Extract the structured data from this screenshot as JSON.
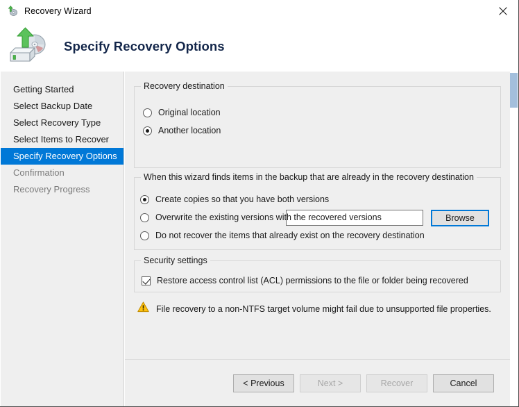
{
  "window": {
    "title": "Recovery Wizard",
    "title_icon": "recovery-disk-icon",
    "close_icon": "close-icon"
  },
  "header": {
    "title": "Specify Recovery Options",
    "icon": "recovery-disk-drive-icon"
  },
  "sidebar": {
    "items": [
      {
        "label": "Getting Started",
        "state": "normal"
      },
      {
        "label": "Select Backup Date",
        "state": "normal"
      },
      {
        "label": "Select Recovery Type",
        "state": "normal"
      },
      {
        "label": "Select Items to Recover",
        "state": "normal"
      },
      {
        "label": "Specify Recovery Options",
        "state": "selected"
      },
      {
        "label": "Confirmation",
        "state": "dim"
      },
      {
        "label": "Recovery Progress",
        "state": "dim"
      }
    ]
  },
  "destination_group": {
    "legend": "Recovery destination",
    "options": [
      {
        "label": "Original location",
        "checked": false
      },
      {
        "label": "Another location",
        "checked": true
      }
    ],
    "path_value": "",
    "path_placeholder": "",
    "browse_label": "Browse"
  },
  "conflict_group": {
    "legend": "When this wizard finds items in the backup that are already in the recovery destination",
    "options": [
      {
        "label": "Create copies so that you have both versions",
        "checked": true
      },
      {
        "label": "Overwrite the existing versions with the recovered versions",
        "checked": false
      },
      {
        "label": "Do not recover the items that already exist on the recovery destination",
        "checked": false
      }
    ]
  },
  "security_group": {
    "legend": "Security settings",
    "checkbox": {
      "label": "Restore access control list (ACL) permissions to the file or folder being recovered",
      "checked": true
    }
  },
  "warning": {
    "icon": "warning-triangle-icon",
    "text": "File recovery to a non-NTFS target volume might fail due to unsupported file properties."
  },
  "footer": {
    "buttons": [
      {
        "label": "< Previous",
        "enabled": true
      },
      {
        "label": "Next >",
        "enabled": false
      },
      {
        "label": "Recover",
        "enabled": false
      },
      {
        "label": "Cancel",
        "enabled": true
      }
    ]
  },
  "colors": {
    "accent": "#0078d7",
    "panel": "#efefef",
    "warning": "#ffc20e",
    "scroll_thumb": "#a3bfdc"
  }
}
